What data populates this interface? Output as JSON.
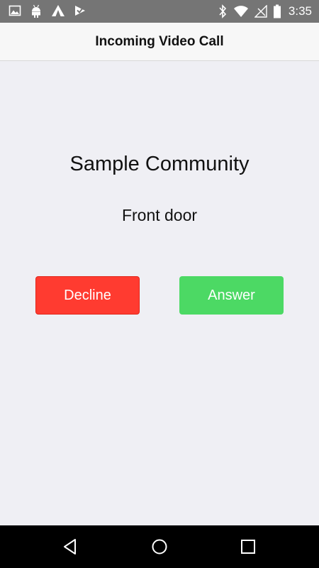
{
  "status_bar": {
    "time": "3:35",
    "left_icons": [
      "image-icon",
      "android-icon",
      "app-icon",
      "check-icon"
    ],
    "right_icons": [
      "bluetooth-icon",
      "wifi-icon",
      "no-signal-icon",
      "battery-icon"
    ]
  },
  "header": {
    "title": "Incoming Video Call"
  },
  "call": {
    "caller": "Sample Community",
    "location": "Front door"
  },
  "buttons": {
    "decline_label": "Decline",
    "answer_label": "Answer"
  },
  "colors": {
    "decline": "#ff3b30",
    "answer": "#4cd964",
    "background": "#efeff4",
    "status_bar": "#757575"
  },
  "android_nav": {
    "icons": [
      "back-icon",
      "home-icon",
      "recents-icon"
    ]
  }
}
